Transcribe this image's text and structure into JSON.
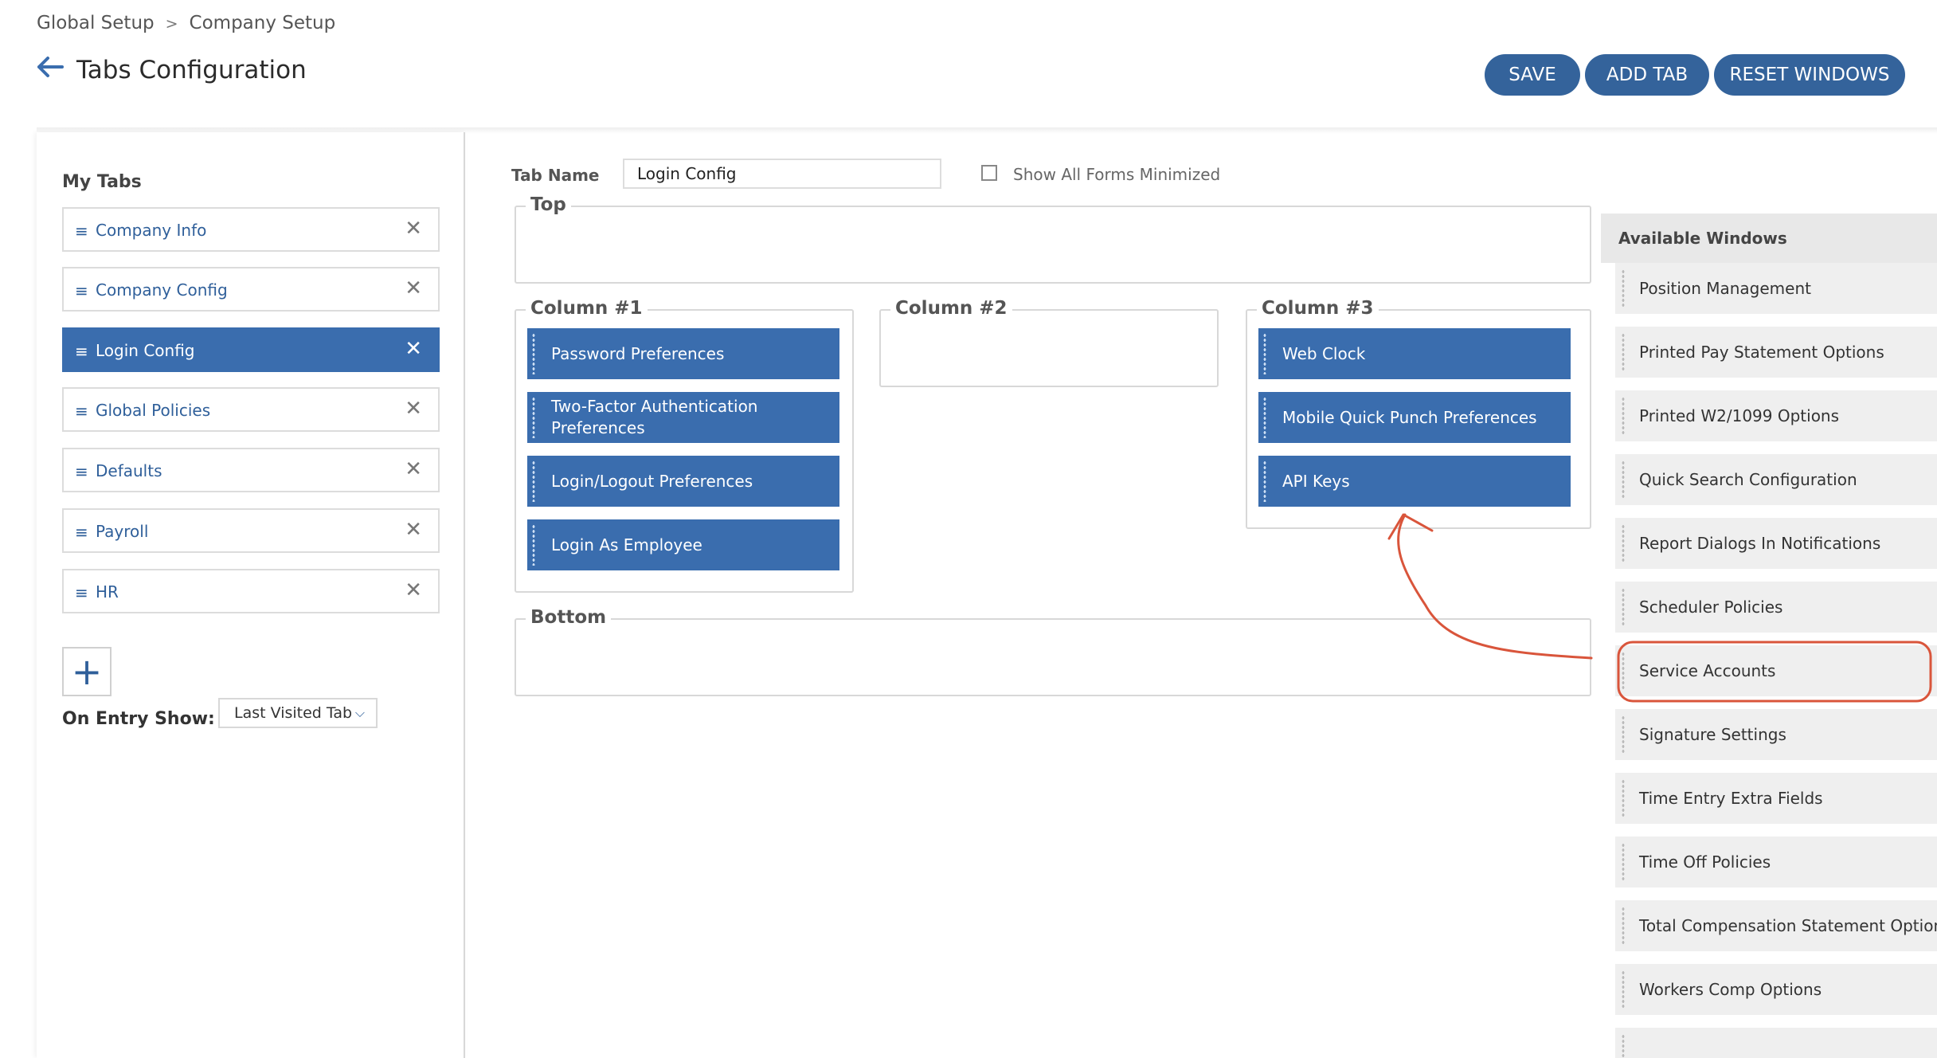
{
  "breadcrumb": {
    "items": [
      "Global Setup",
      "Company Setup"
    ],
    "separator": ">"
  },
  "header": {
    "title": "Tabs Configuration",
    "back_icon": "arrow-left-icon"
  },
  "toolbar": {
    "save_label": "SAVE",
    "add_tab_label": "ADD TAB",
    "reset_label": "RESET WINDOWS"
  },
  "left_panel": {
    "title": "My Tabs",
    "tabs": [
      {
        "label": "Company Info",
        "active": false
      },
      {
        "label": "Company Config",
        "active": false
      },
      {
        "label": "Login Config",
        "active": true
      },
      {
        "label": "Global Policies",
        "active": false
      },
      {
        "label": "Defaults",
        "active": false
      },
      {
        "label": "Payroll",
        "active": false
      },
      {
        "label": "HR",
        "active": false
      }
    ],
    "drag_glyph": "≡",
    "remove_glyph": "✕",
    "add_glyph": "+",
    "on_entry_label": "On Entry Show:",
    "on_entry_value": "Last Visited Tab",
    "chevron_glyph": "⌵"
  },
  "editor": {
    "tab_name_label": "Tab Name",
    "tab_name_value": "Login Config",
    "show_minimized_label": "Show All Forms Minimized",
    "show_minimized_checked": false,
    "top_label": "Top",
    "bottom_label": "Bottom",
    "columns": [
      {
        "label": "Column #1",
        "windows": [
          "Password Preferences",
          "Two-Factor Authentication Preferences",
          "Login/Logout Preferences",
          "Login As Employee"
        ]
      },
      {
        "label": "Column #2",
        "windows": []
      },
      {
        "label": "Column #3",
        "windows": [
          "Web Clock",
          "Mobile Quick Punch Preferences",
          "API Keys"
        ]
      }
    ]
  },
  "available": {
    "title": "Available Windows",
    "items": [
      "Position Management",
      "Printed Pay Statement Options",
      "Printed W2/1099 Options",
      "Quick Search Configuration",
      "Report Dialogs In Notifications",
      "Scheduler Policies",
      "Service Accounts",
      "Signature Settings",
      "Time Entry Extra Fields",
      "Time Off Policies",
      "Total Compensation Statement Options",
      "Workers Comp Options"
    ],
    "highlighted": "Service Accounts"
  },
  "colors": {
    "primary": "#3a6dae",
    "button": "#34639b",
    "annotation": "#d9553b"
  }
}
